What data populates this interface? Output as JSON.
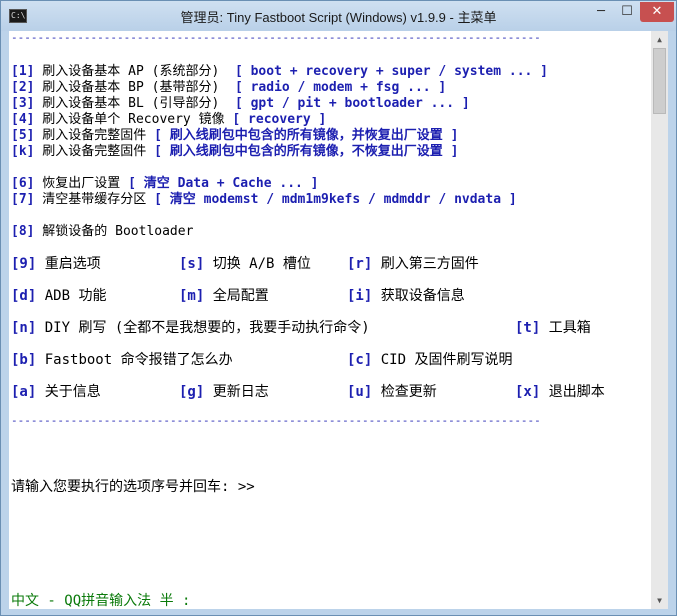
{
  "window": {
    "title": "管理员:  Tiny Fastboot Script (Windows) v1.9.9 - 主菜单",
    "minimize": "─",
    "maximize": "☐",
    "close": "✕"
  },
  "separator_top": "--------------------------------------------------------------------------------",
  "menu": [
    {
      "key": "[1]",
      "text": " 刷入设备基本 AP (系统部分)  ",
      "extra": "[ boot + recovery + super / system ... ]"
    },
    {
      "key": "[2]",
      "text": " 刷入设备基本 BP (基带部分)  ",
      "extra": "[ radio / modem + fsg ... ]"
    },
    {
      "key": "[3]",
      "text": " 刷入设备基本 BL (引导部分)  ",
      "extra": "[ gpt / pit + bootloader ... ]"
    },
    {
      "key": "[4]",
      "text": " 刷入设备单个 Recovery 镜像 ",
      "extra": "[ recovery ]"
    },
    {
      "key": "[5]",
      "text": " 刷入设备完整固件 ",
      "extra": "[ 刷入线刷包中包含的所有镜像，并恢复出厂设置 ]"
    },
    {
      "key": "[k]",
      "text": " 刷入设备完整固件 ",
      "extra": "[ 刷入线刷包中包含的所有镜像，不恢复出厂设置 ]"
    },
    {
      "key": "[6]",
      "text": " 恢复出厂设置 ",
      "extra": "[ 清空 Data + Cache ... ]"
    },
    {
      "key": "[7]",
      "text": " 清空基带缓存分区 ",
      "extra": "[ 清空 modemst / mdm1m9kefs / mdmddr / nvdata ]"
    },
    {
      "key": "[8]",
      "text": " 解锁设备的 Bootloader",
      "extra": ""
    }
  ],
  "grid": [
    [
      {
        "key": "[9]",
        "text": " 重启选项"
      },
      {
        "key": "[s]",
        "text": " 切换 A/B 槽位"
      },
      {
        "key": "[r]",
        "text": " 刷入第三方固件"
      },
      {
        "key": "",
        "text": ""
      }
    ],
    [
      {
        "key": "[d]",
        "text": " ADB 功能"
      },
      {
        "key": "[m]",
        "text": " 全局配置"
      },
      {
        "key": "[i]",
        "text": " 获取设备信息"
      },
      {
        "key": "",
        "text": ""
      }
    ],
    [
      {
        "key": "[n]",
        "text": " DIY 刷写 (全都不是我想要的，我要手动执行命令)"
      },
      {
        "key": "",
        "text": ""
      },
      {
        "key": "",
        "text": ""
      },
      {
        "key": "[t]",
        "text": " 工具箱"
      }
    ],
    [
      {
        "key": "[b]",
        "text": " Fastboot 命令报错了怎么办"
      },
      {
        "key": "",
        "text": ""
      },
      {
        "key": "[c]",
        "text": " CID 及固件刷写说明"
      },
      {
        "key": "",
        "text": ""
      }
    ],
    [
      {
        "key": "[a]",
        "text": " 关于信息"
      },
      {
        "key": "[g]",
        "text": " 更新日志"
      },
      {
        "key": "[u]",
        "text": " 检查更新"
      },
      {
        "key": "[x]",
        "text": " 退出脚本"
      }
    ]
  ],
  "separator_bottom": "--------------------------------------------------------------------------------",
  "prompt": "请输入您要执行的选项序号并回车: >>",
  "ime": "中文 - QQ拼音输入法 半 :"
}
